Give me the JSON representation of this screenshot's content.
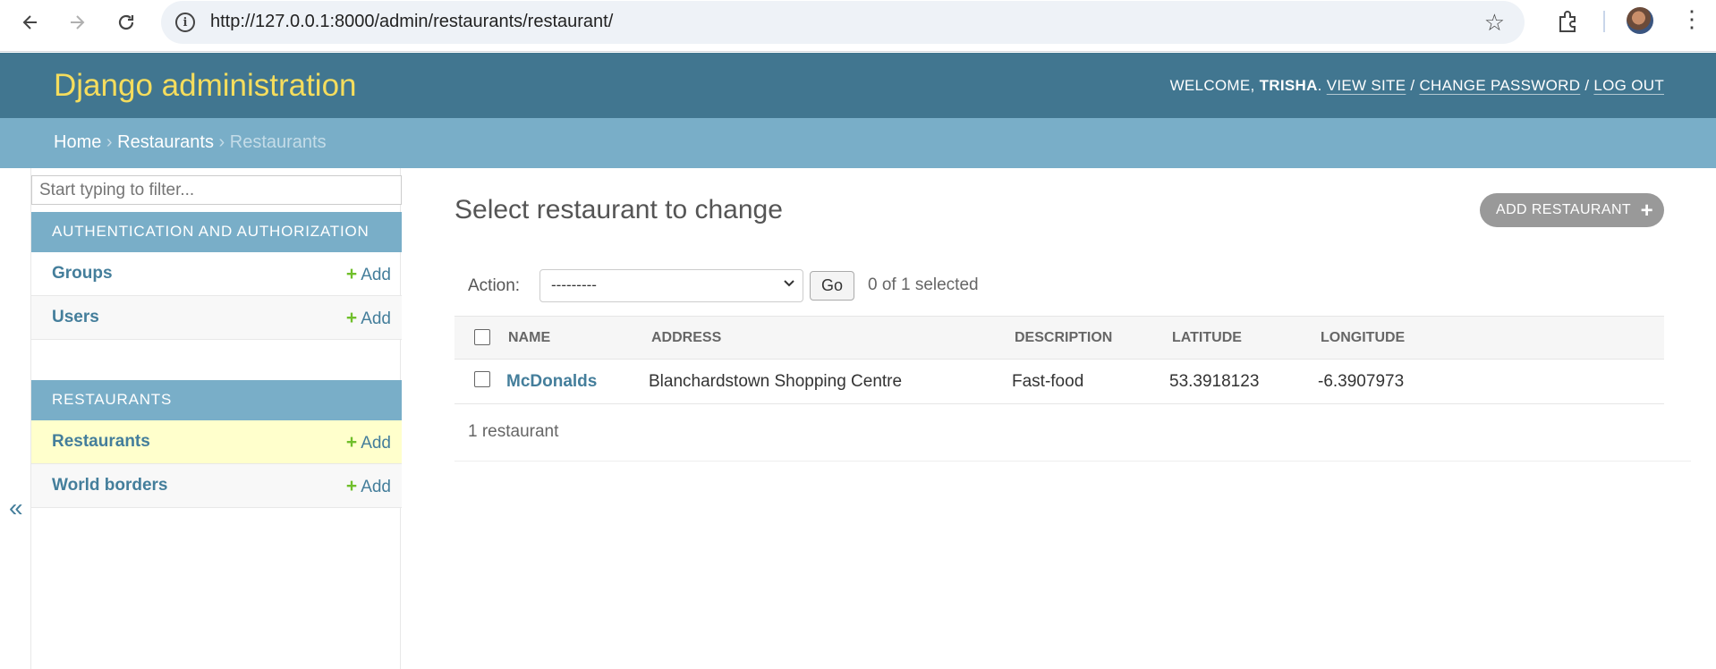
{
  "browser": {
    "url": "http://127.0.0.1:8000/admin/restaurants/restaurant/"
  },
  "header": {
    "site_name": "Django administration",
    "welcome": "WELCOME, ",
    "username": "TRISHA",
    "dot": ". ",
    "view_site": "VIEW SITE",
    "change_password": "CHANGE PASSWORD",
    "log_out": "LOG OUT",
    "sep": " / "
  },
  "breadcrumbs": {
    "home": "Home",
    "app": "Restaurants",
    "current": "Restaurants",
    "sep": " › "
  },
  "sidebar": {
    "filter_placeholder": "Start typing to filter...",
    "apps": [
      {
        "caption": "Authentication and Authorization",
        "models": [
          {
            "name": "Groups",
            "add": "Add"
          },
          {
            "name": "Users",
            "add": "Add"
          }
        ]
      },
      {
        "caption": "Restaurants",
        "models": [
          {
            "name": "Restaurants",
            "add": "Add"
          },
          {
            "name": "World borders",
            "add": "Add"
          }
        ]
      }
    ],
    "collapse": "«"
  },
  "main": {
    "title": "Select restaurant to change",
    "add_button": "ADD RESTAURANT",
    "action_label": "Action:",
    "action_selected": "---------",
    "go": "Go",
    "counter": "0 of 1 selected",
    "columns": [
      "Name",
      "Address",
      "Description",
      "Latitude",
      "Longitude"
    ],
    "rows": [
      {
        "name": "McDonalds",
        "address": "Blanchardstown Shopping Centre",
        "description": "Fast-food",
        "latitude": "53.3918123",
        "longitude": "-6.3907973"
      }
    ],
    "result_count": "1 restaurant"
  },
  "colors": {
    "header_bg": "#417690",
    "site_name": "#f5dd5d",
    "breadcrumbs_bg": "#79aec8",
    "link": "#447e9b",
    "add_green": "#70bf2b",
    "current_row": "#ffffcc"
  }
}
